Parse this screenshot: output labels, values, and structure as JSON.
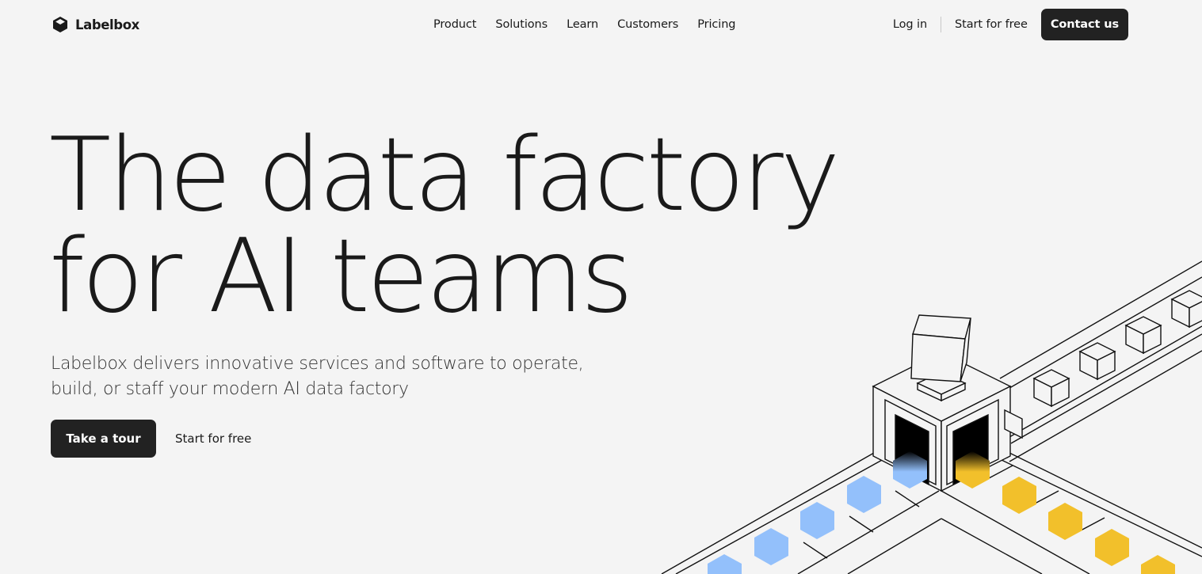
{
  "header": {
    "logo_text": "Labelbox",
    "nav": [
      "Product",
      "Solutions",
      "Learn",
      "Customers",
      "Pricing"
    ],
    "login_label": "Log in",
    "start_free_label": "Start for free",
    "contact_label": "Contact us"
  },
  "hero": {
    "headline_line1": "The data factory",
    "headline_line2": "for AI teams",
    "subtitle_line1": "Labelbox delivers innovative services and software to operate,",
    "subtitle_line2": "build, or staff your modern AI data factory",
    "tour_label": "Take a tour",
    "start_free_label": "Start for free"
  },
  "colors": {
    "background": "#f4f4f4",
    "button_dark": "#222222",
    "hex_blue": "#93c0fb",
    "hex_yellow": "#f2c02b"
  },
  "icons": {
    "logo": "labelbox-cube-icon"
  }
}
